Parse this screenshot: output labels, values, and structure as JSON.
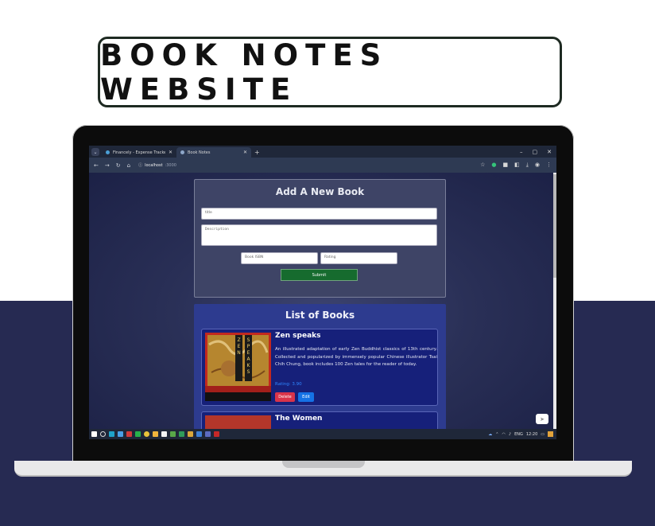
{
  "banner": {
    "title": "BOOK NOTES WEBSITE"
  },
  "browser": {
    "tabs": [
      {
        "label": "Financely - Expense Tracker",
        "active": false
      },
      {
        "label": "Book Notes",
        "active": true
      }
    ],
    "new_tab_symbol": "+",
    "window_controls": [
      "–",
      "▢",
      "✕"
    ],
    "url_host": "localhost",
    "url_port": ":3000"
  },
  "form": {
    "heading": "Add A New Book",
    "title_placeholder": "title",
    "description_placeholder": "Description",
    "isbn_placeholder": "Book ISBN",
    "rating_placeholder": "Rating",
    "submit_label": "Submit"
  },
  "list": {
    "heading": "List of Books",
    "books": [
      {
        "title": "Zen speaks",
        "description": "An illustrated adaptation of early Zen Buddhist classics of 13th century. Collected and popularized by immensely popular Chinese illustrator Tsai Chih Chung, book includes 100 Zen tales for the reader of today.",
        "rating_text": "Rating: 3.90",
        "delete_label": "Delete",
        "edit_label": "Edit",
        "cover_text": [
          "ZEN",
          "SPEAKS"
        ]
      },
      {
        "title": "The Women"
      }
    ]
  },
  "taskbar": {
    "lang": "ENG",
    "time": "12:20"
  },
  "colors": {
    "band": "#262a52",
    "submit": "#166b2e",
    "delete": "#d9344a",
    "edit": "#1572e6",
    "rating": "#2f86ff"
  }
}
